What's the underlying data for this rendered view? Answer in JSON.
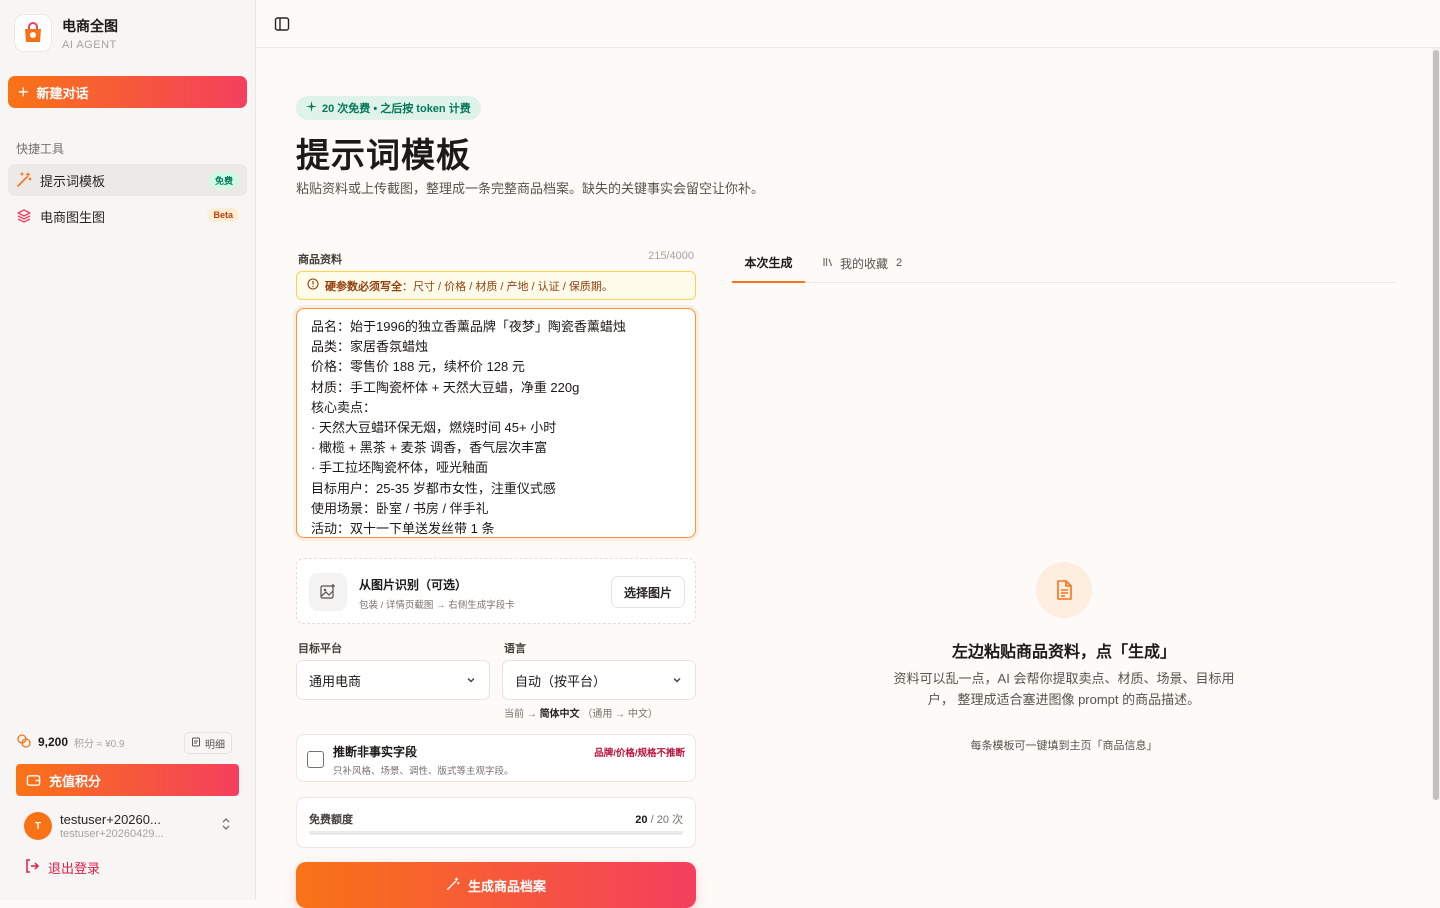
{
  "brand": {
    "name": "电商全图",
    "subtitle": "AI AGENT"
  },
  "sidebar": {
    "new_chat": "新建对话",
    "section_label": "快捷工具",
    "items": [
      {
        "label": "提示词模板",
        "badge": "免费",
        "icon": "magic-wand-icon",
        "active": true
      },
      {
        "label": "电商图生图",
        "badge": "Beta",
        "icon": "layers-icon",
        "active": false
      }
    ],
    "credits": {
      "amount": "9,200",
      "conversion": "积分 ≈ ¥0.9",
      "detail_button": "明细"
    },
    "recharge": "充值积分",
    "user": {
      "avatar": "T",
      "name": "testuser+20260...",
      "email": "testuser+20260429..."
    },
    "logout": "退出登录"
  },
  "main": {
    "pill": "20 次免费 • 之后按 token 计费",
    "title": "提示词模板",
    "description": "粘贴资料或上传截图，整理成一条完整商品档案。缺失的关键事实会留空让你补。",
    "product_label": "商品资料",
    "char_count": "215/4000",
    "warning_bold": "硬参数必须写全",
    "warning_text": "：尺寸 / 价格 / 材质 / 产地 / 认证 / 保质期。",
    "textarea_lines": [
      "品名：始于1996的独立香薰品牌「夜梦」陶瓷香薰蜡烛",
      "品类：家居香氛蜡烛",
      "价格：零售价 188 元，续杯价 128 元",
      "材质：手工陶瓷杯体 + 天然大豆蜡，净重 220g",
      "核心卖点：",
      "· 天然大豆蜡环保无烟，燃烧时间 45+ 小时",
      "· 橄榄 + 黑茶 + 麦茶 调香，香气层次丰富",
      "· 手工拉坯陶瓷杯体，哑光釉面",
      "目标用户：25-35 岁都市女性，注重仪式感",
      "使用场景：卧室 / 书房 / 伴手礼",
      "活动：双十一下单送发丝带 1 条"
    ],
    "upload": {
      "title": "从图片识别（可选）",
      "subtitle": "包装 / 详情页截图 → 右侧生成字段卡",
      "button": "选择图片"
    },
    "platform": {
      "label": "目标平台",
      "value": "通用电商"
    },
    "language": {
      "label": "语言",
      "value": "自动（按平台）",
      "hint_prefix": "当前 →",
      "hint_current": "简体中文",
      "hint_suffix": "（通用 → 中文）"
    },
    "infer": {
      "title": "推断非事实字段",
      "subtitle": "只补风格、场景、调性、版式等主观字段。",
      "warning": "品牌/价格/规格不推断"
    },
    "quota": {
      "label": "免费额度",
      "used": "20",
      "total": " / 20 次",
      "fraction": 0
    },
    "generate": "生成商品档案"
  },
  "right": {
    "tabs": {
      "current": "本次生成",
      "favorites": "我的收藏",
      "favorites_count": "2"
    },
    "empty": {
      "title": "左边粘贴商品资料，点「生成」",
      "description": "资料可以乱一点，AI 会帮你提取卖点、材质、场景、目标用户， 整理成适合塞进图像 prompt 的商品描述。",
      "hint": "每条模板可一键填到主页「商品信息」"
    }
  },
  "colors": {
    "accent_start": "#f97316",
    "accent_end": "#f43f5e",
    "success": "#047857",
    "danger": "#e11d48"
  }
}
